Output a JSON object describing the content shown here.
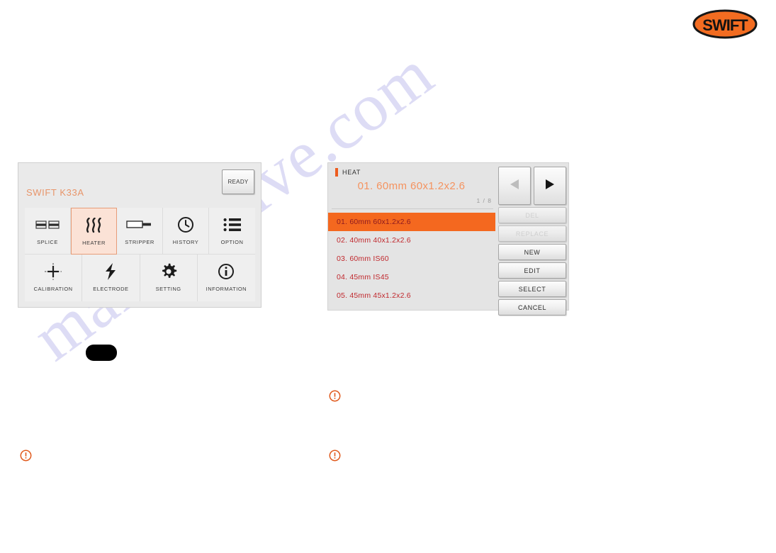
{
  "brand": {
    "logo_text": "SWIFT",
    "logo_bg": "#f26c21",
    "logo_stroke": "#1a1a1a"
  },
  "watermark": {
    "text": "manualslive.com",
    "color": "#c9c7ef"
  },
  "menu_panel": {
    "title": "SWIFT K33A",
    "title_color": "#e8956a",
    "status_button": "READY",
    "active_item": "HEATER",
    "active_bg": "#fbe2d6",
    "active_border": "#e79c78",
    "rows": [
      [
        {
          "label": "SPLICE",
          "icon": "splice-icon"
        },
        {
          "label": "HEATER",
          "icon": "heater-icon"
        },
        {
          "label": "STRIPPER",
          "icon": "stripper-icon"
        },
        {
          "label": "HISTORY",
          "icon": "clock-icon"
        },
        {
          "label": "OPTION",
          "icon": "list-icon"
        }
      ],
      [
        {
          "label": "CALIBRATION",
          "icon": "crosshair-icon"
        },
        {
          "label": "ELECTRODE",
          "icon": "lightning-icon"
        },
        {
          "label": "SETTING",
          "icon": "gear-icon"
        },
        {
          "label": "INFORMATION",
          "icon": "info-icon"
        }
      ]
    ]
  },
  "heat_panel": {
    "tag_label": "HEAT",
    "tag_color": "#ed5c1f",
    "current_value": "01. 60mm 60x1.2x2.6",
    "current_color": "#f5935f",
    "page_indicator": "1 / 8",
    "selected_index": 0,
    "selected_bg": "#f4681f",
    "item_color": "#c0282d",
    "items": [
      "01. 60mm 60x1.2x2.6",
      "02. 40mm 40x1.2x2.6",
      "03. 60mm IS60",
      "04. 45mm IS45",
      "05. 45mm 45x1.2x2.6"
    ],
    "nav": [
      {
        "name": "prev",
        "glyph": "◀",
        "enabled": false
      },
      {
        "name": "next",
        "glyph": "▶",
        "enabled": true
      }
    ],
    "buttons": [
      {
        "label": "DEL",
        "enabled": false
      },
      {
        "label": "REPLACE",
        "enabled": false
      },
      {
        "label": "NEW",
        "enabled": true
      },
      {
        "label": "EDIT",
        "enabled": true
      },
      {
        "label": "SELECT",
        "enabled": true
      },
      {
        "label": "CANCEL",
        "enabled": true
      }
    ]
  },
  "notes": {
    "icon_color": "#e0591c",
    "count": 3
  },
  "redaction": {
    "color": "#000000"
  }
}
